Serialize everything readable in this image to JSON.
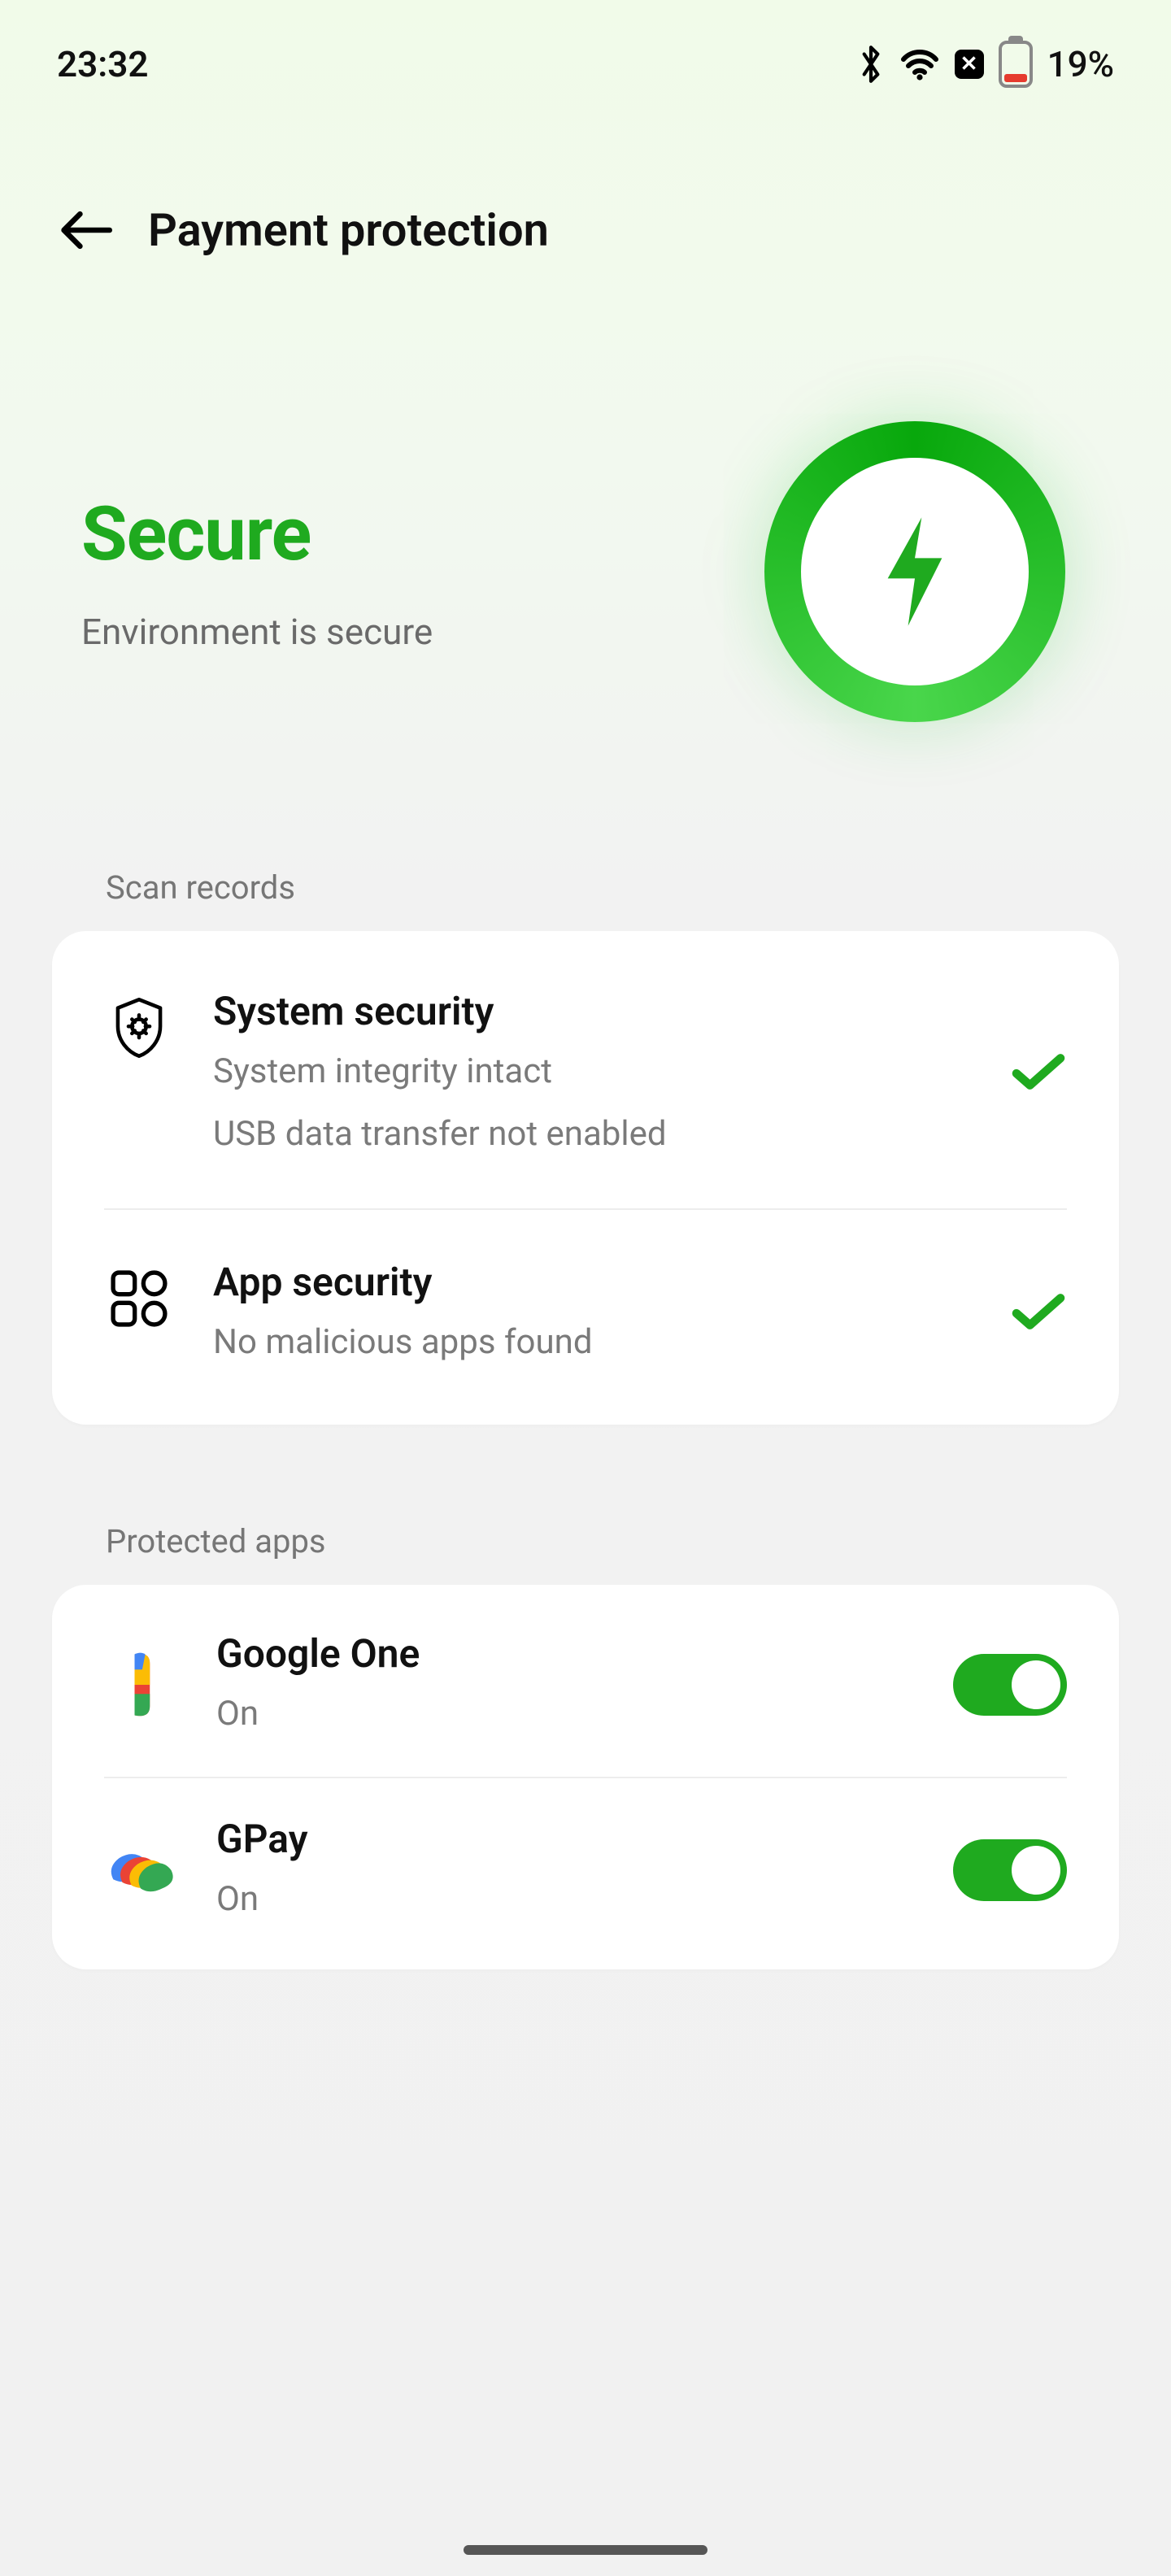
{
  "status": {
    "time": "23:32",
    "battery_pct": "19%"
  },
  "header": {
    "title": "Payment protection"
  },
  "hero": {
    "title": "Secure",
    "subtitle": "Environment is secure"
  },
  "sections": {
    "scan_label": "Scan records",
    "protected_label": "Protected apps"
  },
  "scan": [
    {
      "title": "System security",
      "line1": "System integrity intact",
      "line2": "USB data transfer not enabled"
    },
    {
      "title": "App security",
      "line1": "No malicious apps found"
    }
  ],
  "apps": [
    {
      "name": "Google One",
      "state": "On",
      "toggle": true
    },
    {
      "name": "GPay",
      "state": "On",
      "toggle": true
    }
  ]
}
